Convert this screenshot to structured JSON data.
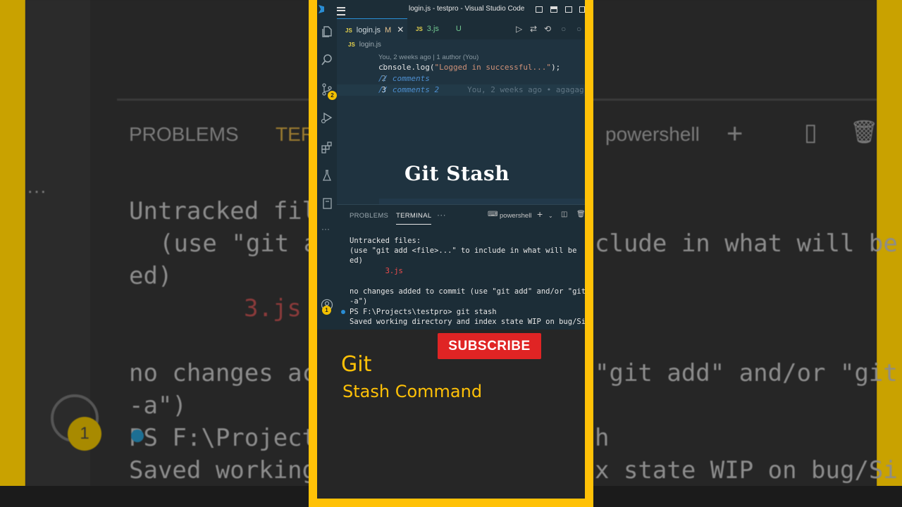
{
  "background": {
    "panel_tabs": [
      "PROBLEMS",
      "TER"
    ],
    "shell": "powershell",
    "lines": [
      "Untracked fil",
      "(use \"git a",
      "clude in what will be",
      "ed)",
      "3.js",
      "no changes ac",
      "\"git add\" and/or \"git",
      "-a\")",
      "PS F:\\Project",
      "h",
      "Saved working",
      "x state WIP on bug/Si"
    ],
    "badge": "1"
  },
  "window": {
    "title": "login.js - testpro - Visual Studio Code"
  },
  "activity": {
    "scm_badge": "2",
    "accounts_badge": "1"
  },
  "tabs": [
    {
      "icon": "JS",
      "name": "login.js",
      "status": "M",
      "close": "✕"
    },
    {
      "icon": "JS",
      "name": "3.js",
      "status": "U"
    }
  ],
  "breadcrumb": {
    "icon": "JS",
    "file": "login.js"
  },
  "editor": {
    "blame_header": "You, 2 weeks ago | 1 author (You)",
    "lines": [
      {
        "num": "1",
        "fn": "console.log",
        "open": "(",
        "str": "\"Logged in successful...\"",
        "close": ");"
      },
      {
        "num": "2",
        "comment": "// comments"
      },
      {
        "num": "3",
        "comment": "// comments 2",
        "blame": "You, 2 weeks ago • agagag"
      }
    ]
  },
  "overlay": {
    "title": "Git Stash"
  },
  "panel": {
    "tabs": [
      "PROBLEMS",
      "TERMINAL"
    ],
    "more": "···",
    "shell": "powershell",
    "terminal": [
      "Untracked files:",
      "  (use \"git add <file>...\" to include in what will be",
      "ed)",
      "        3.js",
      "",
      "no changes added to commit (use \"git add\" and/or \"git",
      "-a\")",
      "PS F:\\Projects\\testpro> git stash",
      "Saved working directory and index state WIP on bug/Si"
    ]
  },
  "promo": {
    "subscribe": "SUBSCRIBE",
    "line1": "Git",
    "line2": "Stash Command"
  },
  "colors": {
    "frame": "#ffc107",
    "subscribe": "#e02424",
    "accent": "#2a8dd4"
  }
}
